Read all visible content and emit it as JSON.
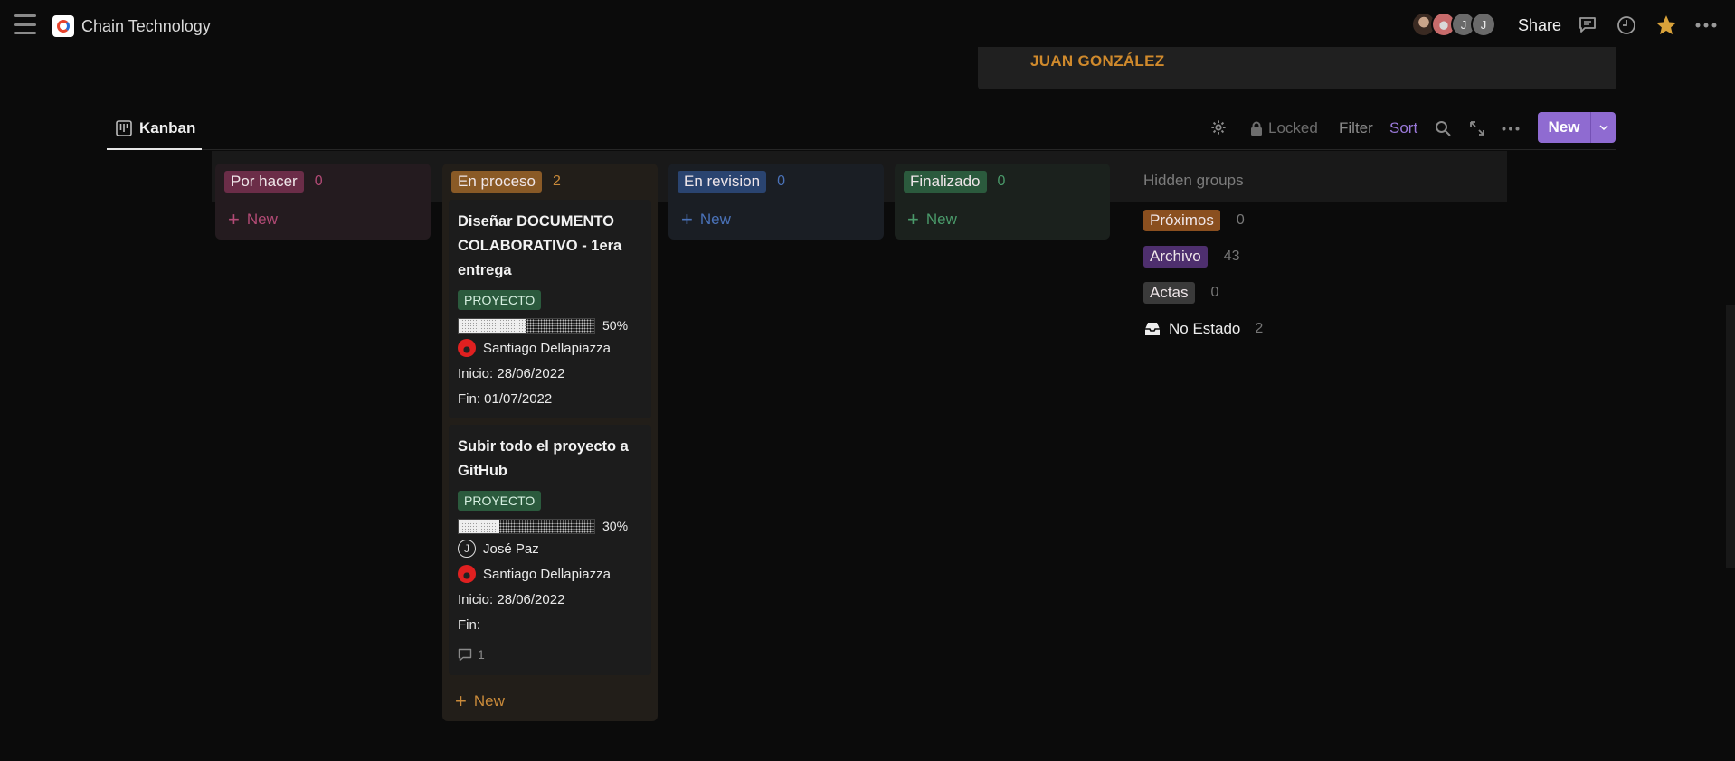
{
  "topbar": {
    "app_title": "Chain Technology",
    "avatars": [
      "photo",
      "photo",
      "J",
      "J"
    ],
    "share_label": "Share",
    "icons": [
      "comment-icon",
      "clock-icon",
      "star-icon",
      "more-icon"
    ],
    "star_color": "#d9a23a"
  },
  "header_card": {
    "name": "JUAN GONZÁLEZ",
    "color": "#d08a2c"
  },
  "viewbar": {
    "tab_label": "Kanban",
    "locked_label": "Locked",
    "filter_label": "Filter",
    "sort_label": "Sort",
    "new_label": "New",
    "accent": "#8f6bd1"
  },
  "columns": [
    {
      "label": "Por hacer",
      "count": "0",
      "new_label": "New",
      "pill_bg": "#6b2d48",
      "bg": "#241b1f",
      "count_color": "#b24a75",
      "new_color": "#b24a75"
    },
    {
      "label": "En proceso",
      "count": "2",
      "new_label": "New",
      "pill_bg": "#8a5a26",
      "bg": "#221e19",
      "count_color": "#c98a3a",
      "new_color": "#c98a3a"
    },
    {
      "label": "En revision",
      "count": "0",
      "new_label": "New",
      "pill_bg": "#2a4470",
      "bg": "#1a1e24",
      "count_color": "#4a72b8",
      "new_color": "#4a72b8"
    },
    {
      "label": "Finalizado",
      "count": "0",
      "new_label": "New",
      "pill_bg": "#2b5a3d",
      "bg": "#1b211d",
      "count_color": "#4a9a6a",
      "new_color": "#4a9a6a"
    }
  ],
  "cards": [
    {
      "title": "Diseñar DOCUMENTO COLABORATIVO - 1era entrega",
      "tag": "PROYECTO",
      "progress": 0.5,
      "progress_label": "50%",
      "people": [
        "Santiago Dellapiazza"
      ],
      "inicio": "Inicio: 28/06/2022",
      "fin": "Fin: 01/07/2022"
    },
    {
      "title": "Subir todo el proyecto a GitHub",
      "tag": "PROYECTO",
      "progress": 0.3,
      "progress_label": "30%",
      "people": [
        "José Paz",
        "Santiago Dellapiazza"
      ],
      "inicio": "Inicio: 28/06/2022",
      "fin": "Fin:",
      "comments": "1"
    }
  ],
  "hidden_groups": {
    "title": "Hidden groups",
    "items": [
      {
        "label": "Próximos",
        "count": "0",
        "pill_bg": "#8a4f1f"
      },
      {
        "label": "Archivo",
        "count": "43",
        "pill_bg": "#4e2f6e"
      },
      {
        "label": "Actas",
        "count": "0",
        "pill_bg": "#3a3a3a"
      }
    ],
    "no_estado": {
      "label": "No Estado",
      "count": "2"
    }
  }
}
